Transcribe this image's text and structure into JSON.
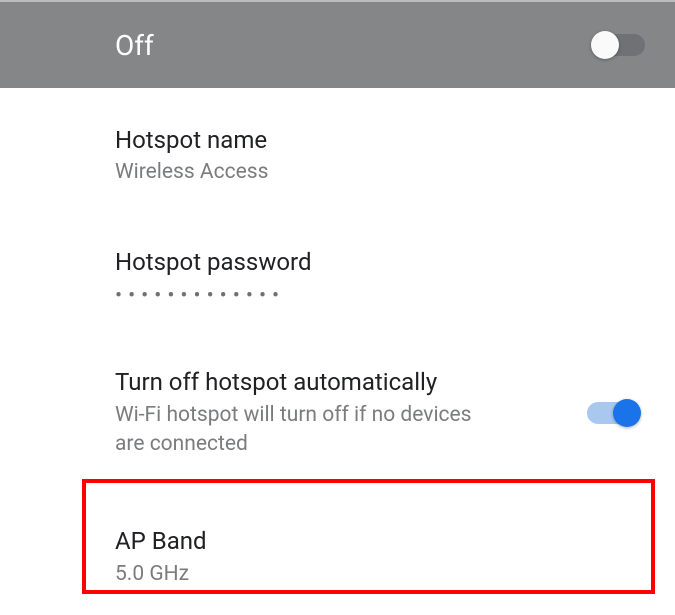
{
  "header": {
    "status_label": "Off",
    "master_toggle_on": false
  },
  "rows": {
    "hotspot_name": {
      "title": "Hotspot name",
      "value": "Wireless Access"
    },
    "hotspot_password": {
      "title": "Hotspot password",
      "masked": "•••••••••••••"
    },
    "auto_off": {
      "title": "Turn off hotspot automatically",
      "subtitle": "Wi-Fi hotspot will turn off if no devices are connected",
      "toggle_on": true
    },
    "ap_band": {
      "title": "AP Band",
      "value": "5.0 GHz"
    }
  }
}
